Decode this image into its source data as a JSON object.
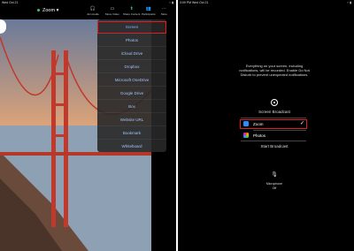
{
  "left": {
    "status": {
      "time": "Wed Oct 21",
      "right": "⌁ ▮"
    },
    "meeting_title": "Zoom",
    "toolbar": [
      {
        "label": "Join Audio",
        "icon": "headphones-icon",
        "glyph": "🎧"
      },
      {
        "label": "Move Video",
        "icon": "video-icon",
        "glyph": "▭"
      },
      {
        "label": "Share Content",
        "icon": "share-icon",
        "glyph": "⬆"
      },
      {
        "label": "Participants",
        "icon": "participants-icon",
        "glyph": "👥"
      },
      {
        "label": "More",
        "icon": "more-icon",
        "glyph": "⋯"
      }
    ],
    "share_menu": [
      "Screen",
      "Photos",
      "iCloud Drive",
      "Dropbox",
      "Microsoft OneDrive",
      "Google Drive",
      "Box",
      "Website URL",
      "Bookmark",
      "Whiteboard"
    ]
  },
  "right": {
    "status": {
      "time": "3:09 PM  Wed Oct 21",
      "right": "⌁ ▮"
    },
    "message": "Everything on your screen, including notifications, will be recorded. Enable Do Not Disturb to prevent unexpected notifications.",
    "broadcast_label": "Screen Broadcast",
    "options": [
      {
        "label": "Zoom",
        "selected": true,
        "color": "#2d8cff"
      },
      {
        "label": "Photos",
        "selected": false,
        "color": "#f0a030"
      }
    ],
    "start_label": "Start Broadcast",
    "mic_label": "Microphone",
    "mic_state": "Off"
  }
}
